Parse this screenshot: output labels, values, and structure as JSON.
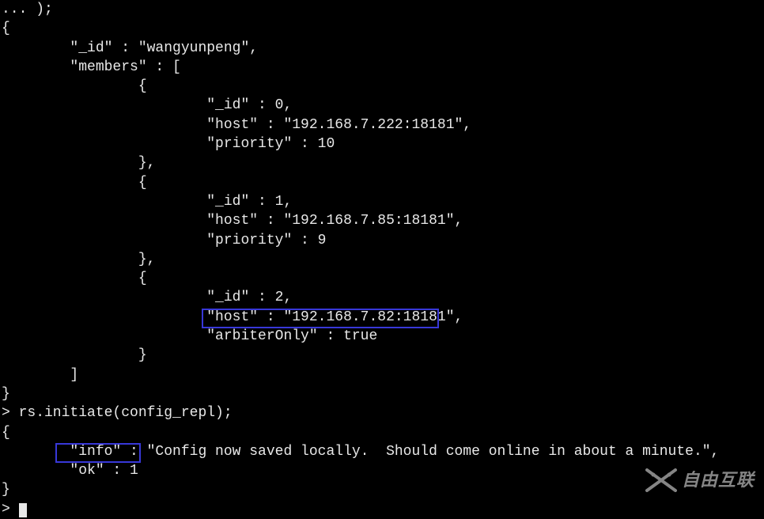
{
  "terminal": {
    "lines": [
      "... );",
      "{",
      "        \"_id\" : \"wangyunpeng\",",
      "        \"members\" : [",
      "                {",
      "                        \"_id\" : 0,",
      "                        \"host\" : \"192.168.7.222:18181\",",
      "                        \"priority\" : 10",
      "                },",
      "                {",
      "                        \"_id\" : 1,",
      "                        \"host\" : \"192.168.7.85:18181\",",
      "                        \"priority\" : 9",
      "                },",
      "                {",
      "                        \"_id\" : 2,",
      "                        \"host\" : \"192.168.7.82:18181\",",
      "                        \"arbiterOnly\" : true",
      "                }",
      "        ]",
      "}",
      "> rs.initiate(config_repl);",
      "{",
      "        \"info\" : \"Config now saved locally.  Should come online in about a minute.\",",
      "        \"ok\" : 1",
      "}",
      "> "
    ]
  },
  "watermark": {
    "text": "自由互联"
  }
}
